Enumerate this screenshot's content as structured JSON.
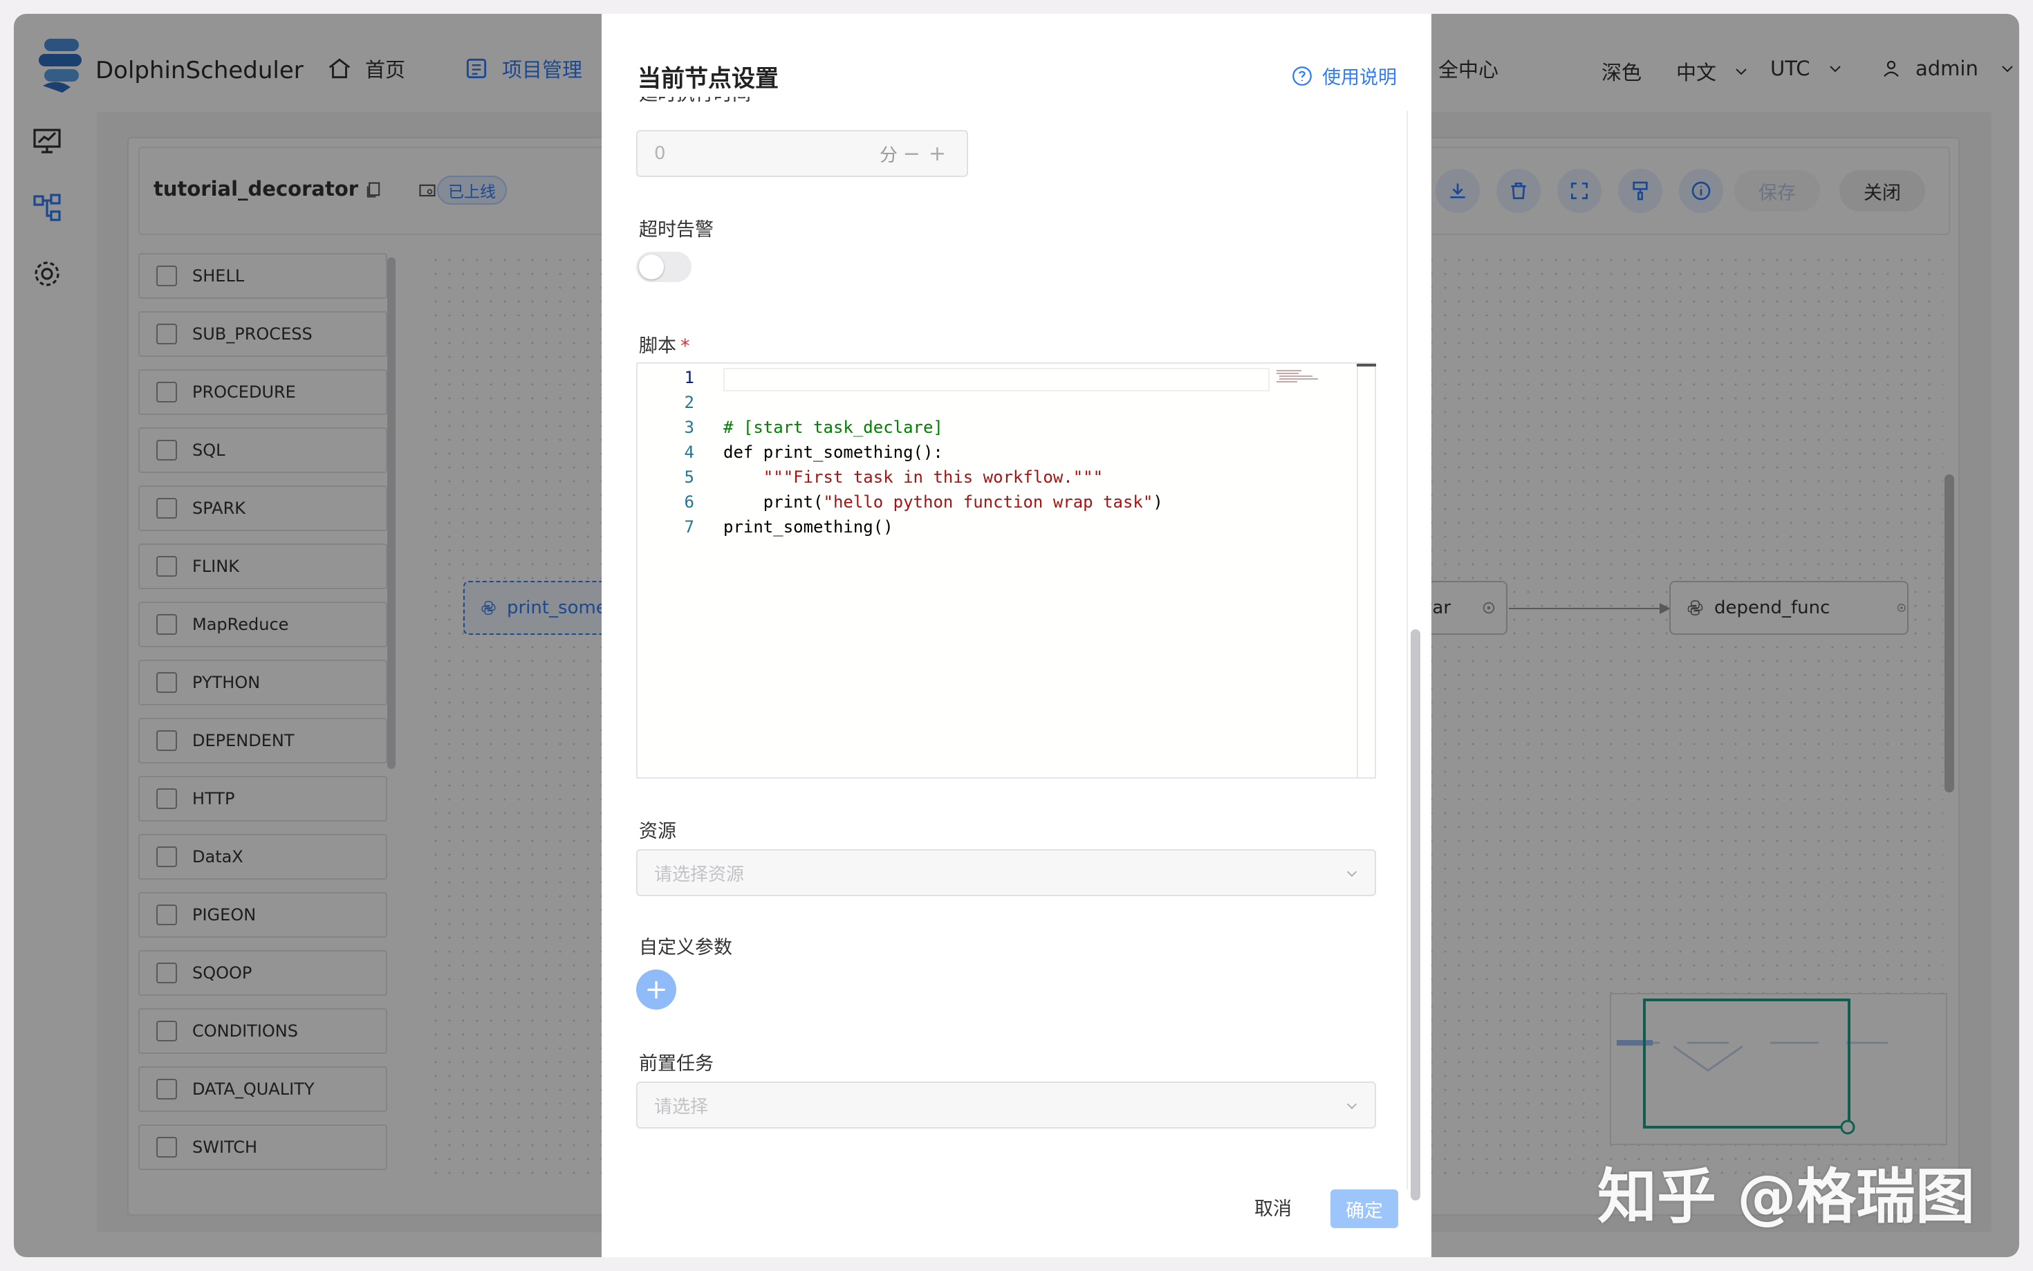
{
  "app": {
    "brand": "DolphinScheduler"
  },
  "nav": {
    "home": "首页",
    "project": "项目管理",
    "security_partial": "全中心",
    "theme": "深色",
    "language": "中文",
    "timezone": "UTC",
    "user": "admin"
  },
  "workflow": {
    "title": "tutorial_decorator",
    "status_badge": "已上线",
    "save": "保存",
    "close": "关闭"
  },
  "task_types": [
    "SHELL",
    "SUB_PROCESS",
    "PROCEDURE",
    "SQL",
    "SPARK",
    "FLINK",
    "MapReduce",
    "PYTHON",
    "DEPENDENT",
    "HTTP",
    "DataX",
    "PIGEON",
    "SQOOP",
    "CONDITIONS",
    "DATA_QUALITY",
    "SWITCH"
  ],
  "nodes": {
    "n1": "print_somet",
    "n2": "var",
    "n3": "depend_func"
  },
  "modal": {
    "title": "当前节点设置",
    "help": "使用说明",
    "delay_label_partial": "延时执行时间",
    "delay_value": "0",
    "delay_unit": "分",
    "timeout_alarm_label": "超时告警",
    "timeout_alarm_on": false,
    "script_label": "脚本",
    "script_lines": [
      "",
      "",
      "# [start task_declare]",
      "def print_something():",
      "    \"\"\"First task in this workflow.\"\"\"",
      "    print(\"hello python function wrap task\")",
      "print_something()"
    ],
    "resource_label": "资源",
    "resource_placeholder": "请选择资源",
    "custom_params_label": "自定义参数",
    "pre_tasks_label": "前置任务",
    "pre_tasks_placeholder": "请选择",
    "cancel": "取消",
    "confirm": "确定"
  },
  "watermark": "知乎 @格瑞图",
  "colors": {
    "accent": "#2f7cf6",
    "minimap_frame": "#1aa38a"
  }
}
